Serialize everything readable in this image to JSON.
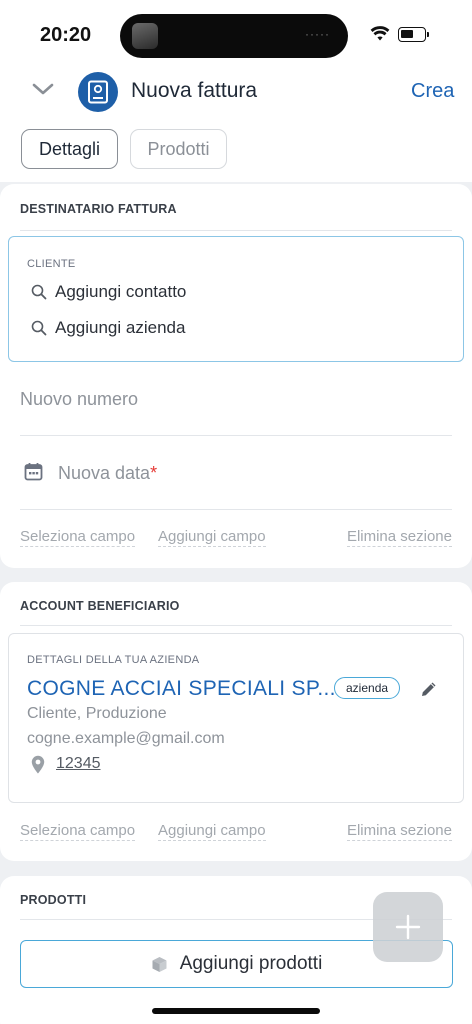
{
  "status_bar": {
    "time": "20:20",
    "island_dots": "·····"
  },
  "header": {
    "title": "Nuova fattura",
    "action": "Crea"
  },
  "tabs": [
    {
      "label": "Dettagli",
      "active": true
    },
    {
      "label": "Prodotti",
      "active": false
    }
  ],
  "recipient_section": {
    "title": "DESTINATARIO FATTURA",
    "client_label": "CLIENTE",
    "add_contact": "Aggiungi contatto",
    "add_company": "Aggiungi azienda",
    "number_placeholder": "Nuovo numero",
    "date_placeholder": "Nuova data",
    "required_mark": "*",
    "select_field": "Seleziona campo",
    "add_field": "Aggiungi campo",
    "delete_section": "Elimina sezione"
  },
  "beneficiary_section": {
    "title": "ACCOUNT BENEFICIARIO",
    "company_details_label": "DETTAGLI DELLA TUA AZIENDA",
    "company_name": "COGNE ACCIAI SPECIALI SP...",
    "badge": "azienda",
    "tags": "Cliente, Produzione",
    "email": "cogne.example@gmail.com",
    "postal_code": "12345",
    "select_field": "Seleziona campo",
    "add_field": "Aggiungi campo",
    "delete_section": "Elimina sezione"
  },
  "products_section": {
    "title": "PRODOTTI",
    "add_products": "Aggiungi prodotti"
  },
  "colors": {
    "accent": "#1e64b4",
    "border_focus": "#8cc6e6",
    "app_icon": "#1e5fa8",
    "required": "#e53935"
  }
}
